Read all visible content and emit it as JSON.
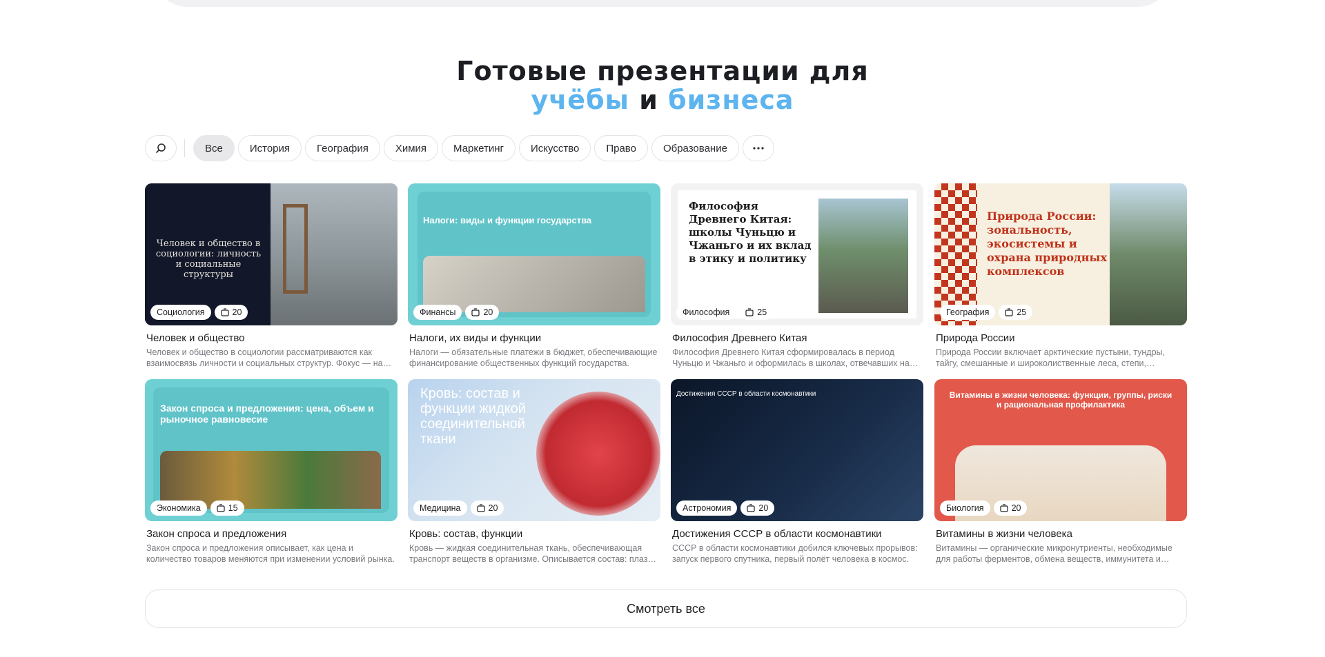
{
  "hero": {
    "title_line1": "Готовые презентации для",
    "accent_word1": "учёбы",
    "connector": "и",
    "accent_word2": "бизнеса",
    "accent_color": "#5db4ee"
  },
  "filters": {
    "search_icon": "search-icon",
    "items": [
      "Все",
      "История",
      "География",
      "Химия",
      "Маркетинг",
      "Искусство",
      "Право",
      "Образование"
    ],
    "active": "Все",
    "more_icon": "more-dots-icon"
  },
  "cards": [
    {
      "category": "Социология",
      "slides": "20",
      "thumb_text": "Человек и общество в социологии: личность и социальные структуры",
      "title": "Человек и общество",
      "desc": "Человек и общество в социологии рассматриваются как взаимосвязь личности и социальных структур. Фокус — на взаимодействии людей."
    },
    {
      "category": "Финансы",
      "slides": "20",
      "thumb_text": "Налоги: виды и функции государства",
      "title": "Налоги, их виды и функции",
      "desc": "Налоги — обязательные платежи в бюджет, обеспечивающие финансирование общественных функций государства."
    },
    {
      "category": "Философия",
      "slides": "25",
      "thumb_text": "Философия Древнего Китая: школы Чуньцю и Чжаньго и их вклад в этику и политику",
      "title": "Философия Древнего Китая",
      "desc": "Философия Древнего Китая сформировалась в период Чуньцю и Чжаньго и оформилась в школах, отвечавших на кризис эпохи."
    },
    {
      "category": "География",
      "slides": "25",
      "thumb_text": "Природа России: зональность, экосистемы и охрана природных комплексов",
      "title": "Природа России",
      "desc": "Природа России включает арктические пустыни, тундры, тайгу, смешанные и широколиственные леса, степи, полупустыни."
    },
    {
      "category": "Экономика",
      "slides": "15",
      "thumb_text": "Закон спроса и предложения: цена, объем и рыночное равновесие",
      "title": "Закон спроса и предложения",
      "desc": "Закон спроса и предложения описывает, как цена и количество товаров меняются при изменении условий рынка."
    },
    {
      "category": "Медицина",
      "slides": "20",
      "thumb_text": "Кровь: состав и функции жидкой соединительной ткани",
      "title": "Кровь: состав, функции",
      "desc": "Кровь — жидкая соединительная ткань, обеспечивающая транспорт веществ в организме. Описывается состав: плазма и клетки."
    },
    {
      "category": "Астрономия",
      "slides": "20",
      "thumb_text": "Достижения СССР в области космонавтики",
      "title": "Достижения СССР в области космонавтики",
      "desc": "СССР в области космонавтики добился ключевых прорывов: запуск первого спутника, первый полёт человека в космос."
    },
    {
      "category": "Биология",
      "slides": "20",
      "thumb_text": "Витамины в жизни человека: функции, группы, риски и рациональная профилактика",
      "title": "Витамины в жизни человека",
      "desc": "Витамины — органические микронутриенты, необходимые для работы ферментов, обмена веществ, иммунитета и восстановления тканей."
    }
  ],
  "see_all_label": "Смотреть все"
}
